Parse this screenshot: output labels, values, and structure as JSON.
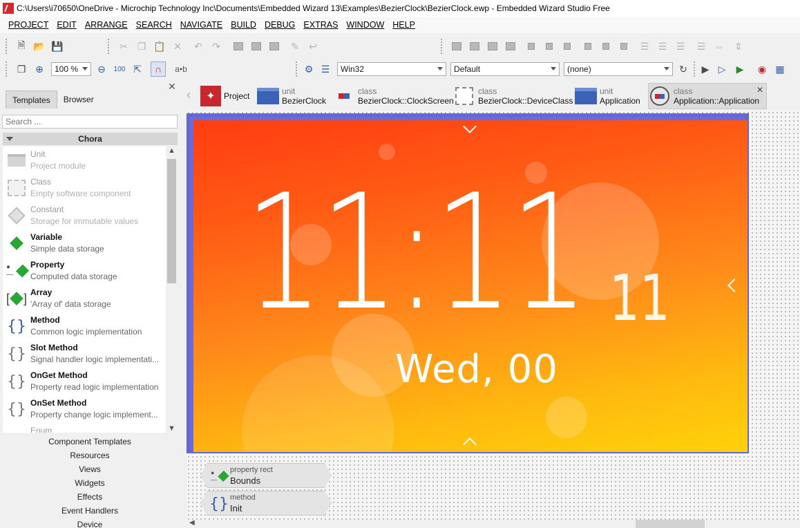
{
  "window": {
    "title": "C:\\Users\\i70650\\OneDrive - Microchip Technology Inc\\Documents\\Embedded Wizard 13\\Examples\\BezierClock\\BezierClock.ewp - Embedded Wizard Studio Free"
  },
  "menu": [
    "PROJECT",
    "EDIT",
    "ARRANGE",
    "SEARCH",
    "NAVIGATE",
    "BUILD",
    "DEBUG",
    "EXTRAS",
    "WINDOW",
    "HELP"
  ],
  "toolbar": {
    "zoom_value": "100 %",
    "ab_label": "a•b",
    "platform_value": "Win32",
    "profile_value": "Default",
    "language_value": "(none)"
  },
  "left_panel": {
    "tabs": [
      "Templates",
      "Browser"
    ],
    "search_placeholder": "Search ...",
    "group": "Chora",
    "templates": [
      {
        "name": "Unit",
        "desc": "Project module",
        "icon": "unit-icon",
        "enabled": false
      },
      {
        "name": "Class",
        "desc": "Empty software component",
        "icon": "class-icon",
        "enabled": false
      },
      {
        "name": "Constant",
        "desc": "Storage for immutable values",
        "icon": "constant-icon",
        "enabled": false
      },
      {
        "name": "Variable",
        "desc": "Simple data storage",
        "icon": "variable-icon",
        "enabled": true
      },
      {
        "name": "Property",
        "desc": "Computed data storage",
        "icon": "property-icon",
        "enabled": true
      },
      {
        "name": "Array",
        "desc": "'Array of' data storage",
        "icon": "array-icon",
        "enabled": true
      },
      {
        "name": "Method",
        "desc": "Common logic implementation",
        "icon": "method-icon",
        "enabled": true
      },
      {
        "name": "Slot Method",
        "desc": "Signal handler logic implementati...",
        "icon": "slot-method-icon",
        "enabled": true
      },
      {
        "name": "OnGet Method",
        "desc": "Property read logic implementation",
        "icon": "onget-method-icon",
        "enabled": true
      },
      {
        "name": "OnSet Method",
        "desc": "Property change logic implement...",
        "icon": "onset-method-icon",
        "enabled": true
      },
      {
        "name": "Enum",
        "desc": "",
        "icon": "enum-icon",
        "enabled": false
      }
    ],
    "categories": [
      "Component Templates",
      "Resources",
      "Views",
      "Widgets",
      "Effects",
      "Event Handlers",
      "Device"
    ]
  },
  "doc_tabs": [
    {
      "kind": "",
      "name": "Project",
      "icon": "project-icon"
    },
    {
      "kind": "unit",
      "name": "BezierClock",
      "icon": "unit-folder-icon"
    },
    {
      "kind": "class",
      "name": "BezierClock::ClockScreen",
      "icon": "class-icon"
    },
    {
      "kind": "class",
      "name": "BezierClock::DeviceClass",
      "icon": "device-class-icon"
    },
    {
      "kind": "unit",
      "name": "Application",
      "icon": "unit-folder-icon"
    },
    {
      "kind": "class",
      "name": "Application::Application",
      "icon": "class-icon"
    }
  ],
  "clock": {
    "time": "11:11",
    "seconds": "11",
    "date": "Wed,  00"
  },
  "members": [
    {
      "kind": "property rect",
      "name": "Bounds",
      "icon": "property-icon"
    },
    {
      "kind": "method",
      "name": "Init",
      "icon": "method-icon"
    }
  ],
  "colors": {
    "accent_blue": "#3a62b6",
    "diamond_green": "#27a832",
    "screen_top": "#ff3d12",
    "screen_bottom": "#ffd20a"
  }
}
